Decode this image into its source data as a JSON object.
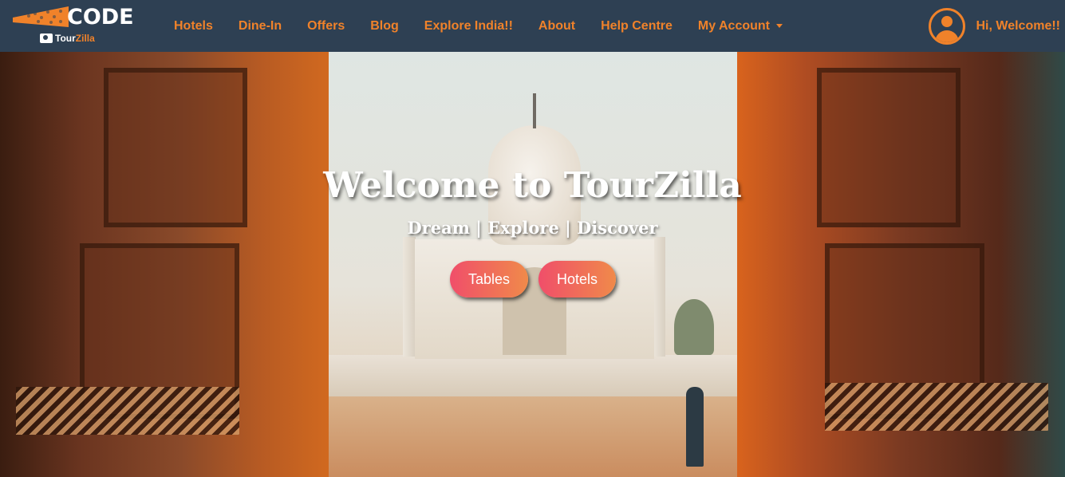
{
  "brand": {
    "code_text": "CODE",
    "sub_part1": "Tour",
    "sub_part2": "Zilla"
  },
  "nav": {
    "items": [
      {
        "label": "Hotels"
      },
      {
        "label": "Dine-In"
      },
      {
        "label": "Offers"
      },
      {
        "label": "Blog"
      },
      {
        "label": "Explore India!!"
      },
      {
        "label": "About"
      },
      {
        "label": "Help Centre"
      },
      {
        "label": "My Account"
      }
    ],
    "greeting": "Hi, Welcome!!"
  },
  "hero": {
    "title": "Welcome to TourZilla",
    "subtitle": "Dream | Explore | Discover",
    "buttons": [
      {
        "label": "Tables"
      },
      {
        "label": "Hotels"
      }
    ]
  },
  "colors": {
    "navbar_bg": "#2e4053",
    "accent": "#f0822a",
    "button_gradient_start": "#f04e6a",
    "button_gradient_end": "#f08a4a"
  },
  "icons": {
    "avatar": "user-circle-icon",
    "dropdown": "caret-down-icon",
    "logo": "brand-logo"
  }
}
